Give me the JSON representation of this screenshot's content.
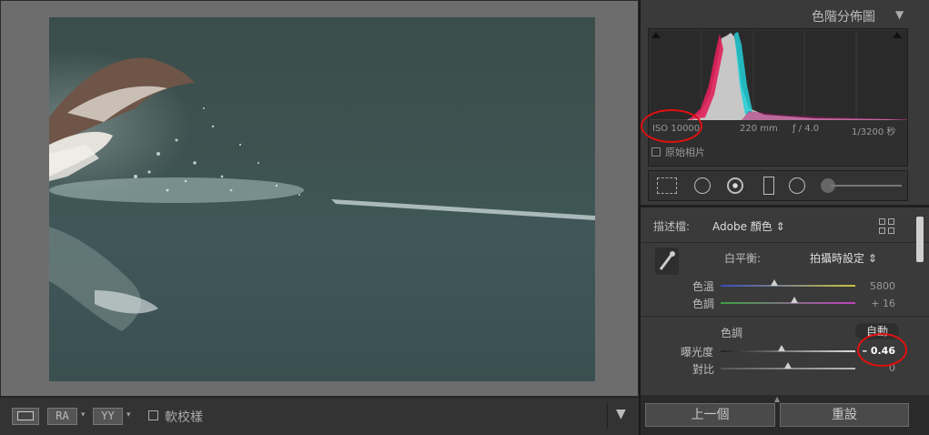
{
  "histogram": {
    "title": "色階分佈圖",
    "iso": "ISO 10000",
    "focal": "220 mm",
    "aperture": "ƒ / 4.0",
    "shutter": "1/3200 秒",
    "original_photo_label": "原始相片"
  },
  "profile": {
    "label": "描述檔:",
    "value": "Adobe 顏色 ⇕"
  },
  "white_balance": {
    "label": "白平衡:",
    "value": "拍攝時設定 ⇕",
    "temp": {
      "label": "色溫",
      "value": "5800",
      "level": 0.4
    },
    "tint": {
      "label": "色調",
      "value": "+ 16",
      "level": 0.55
    }
  },
  "tone": {
    "header": "色調",
    "auto_label": "自動",
    "exposure": {
      "label": "曝光度",
      "value": "– 0.46",
      "level": 0.45
    },
    "contrast": {
      "label": "對比",
      "value": "0",
      "level": 0.5
    }
  },
  "buttons": {
    "previous": "上一個",
    "reset": "重設"
  },
  "toolbar": {
    "ra_label": "RA",
    "yy_label": "YY",
    "soft_proof_label": "軟校樣"
  },
  "colors": {
    "panel_bg": "#3a3a3a",
    "viewer_bg": "#6d6d6d",
    "annotation": "#e01010"
  }
}
